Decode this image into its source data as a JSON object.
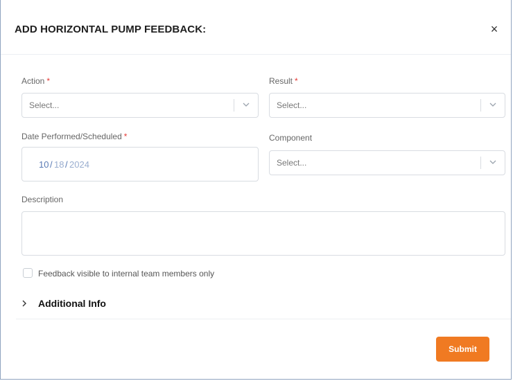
{
  "modal": {
    "title": "ADD HORIZONTAL PUMP FEEDBACK:",
    "close_glyph": "×"
  },
  "form": {
    "action": {
      "label": "Action",
      "required_mark": "*",
      "placeholder": "Select..."
    },
    "result": {
      "label": "Result",
      "required_mark": "*",
      "placeholder": "Select..."
    },
    "date": {
      "label": "Date Performed/Scheduled",
      "required_mark": "*",
      "month": "10",
      "sep1": "/",
      "day": "18",
      "sep2": "/",
      "year": "2024"
    },
    "component": {
      "label": "Component",
      "placeholder": "Select..."
    },
    "description": {
      "label": "Description",
      "value": ""
    },
    "internal_only": {
      "label": "Feedback visible to internal team members only",
      "checked": false
    },
    "additional_info": {
      "label": "Additional Info",
      "expanded": false
    },
    "submit_label": "Submit"
  },
  "colors": {
    "accent": "#f07a22",
    "required": "#e53935",
    "border": "#d8dce1",
    "date_month": "#5a7bb5",
    "date_muted": "#9aaed0"
  },
  "icons": {
    "close": "close-icon",
    "dropdown": "chevron-down-icon",
    "expand": "chevron-right-icon"
  }
}
